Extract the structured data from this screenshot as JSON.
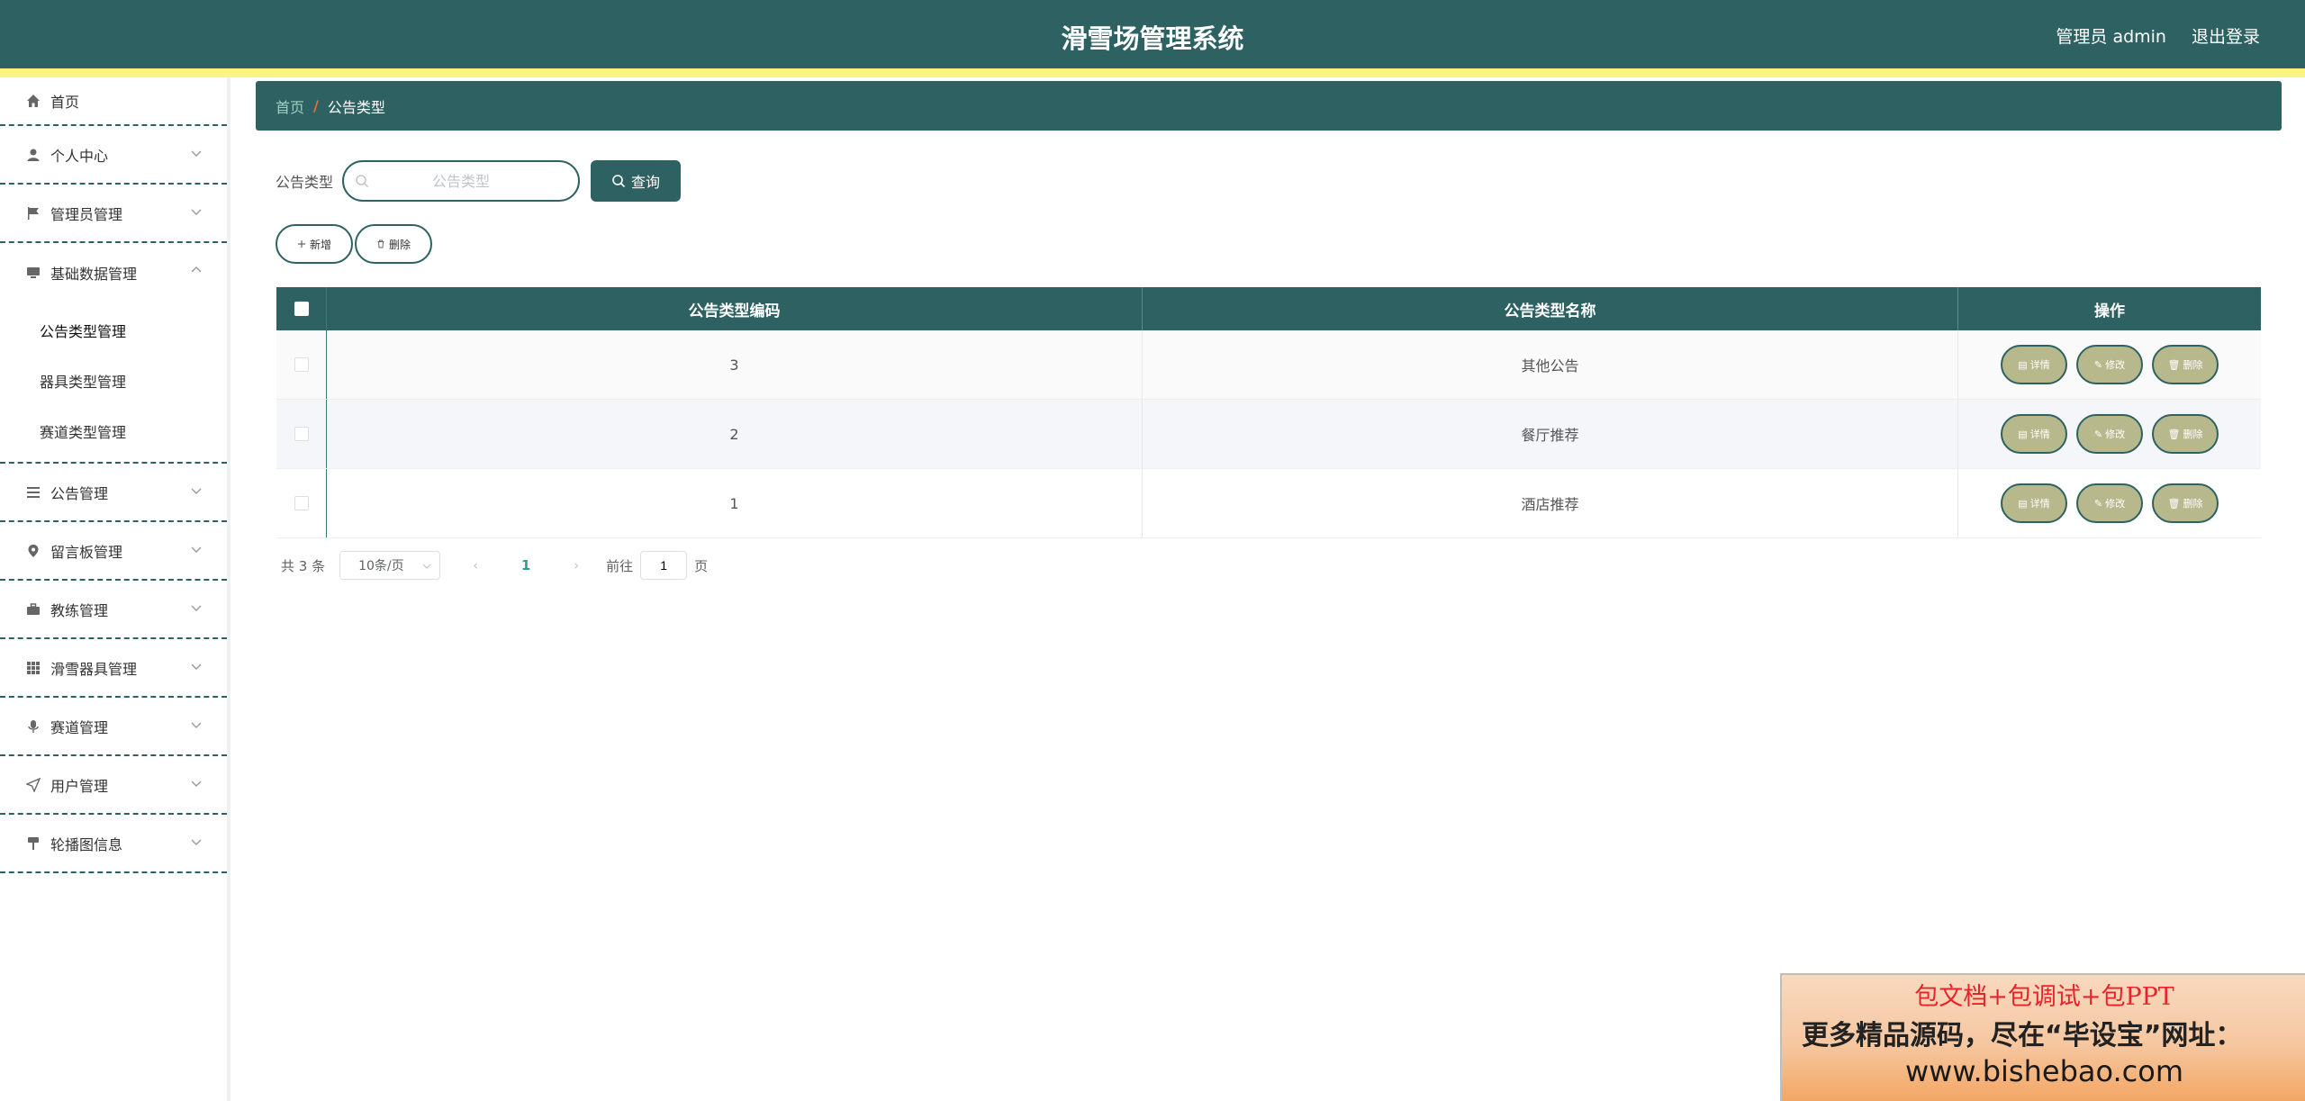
{
  "app": {
    "title": "滑雪场管理系统"
  },
  "header": {
    "user_label": "管理员 admin",
    "logout": "退出登录"
  },
  "sidebar": {
    "items": [
      {
        "label": "首页",
        "icon": "home-icon"
      },
      {
        "label": "个人中心",
        "icon": "user-icon"
      },
      {
        "label": "管理员管理",
        "icon": "flag-icon"
      },
      {
        "label": "基础数据管理",
        "icon": "monitor-icon",
        "expanded": true,
        "children": [
          {
            "label": "公告类型管理",
            "active": true
          },
          {
            "label": "器具类型管理"
          },
          {
            "label": "赛道类型管理"
          }
        ]
      },
      {
        "label": "公告管理",
        "icon": "menu-icon"
      },
      {
        "label": "留言板管理",
        "icon": "pin-icon"
      },
      {
        "label": "教练管理",
        "icon": "briefcase-icon"
      },
      {
        "label": "滑雪器具管理",
        "icon": "grid-icon"
      },
      {
        "label": "赛道管理",
        "icon": "microphone-icon"
      },
      {
        "label": "用户管理",
        "icon": "send-icon"
      },
      {
        "label": "轮播图信息",
        "icon": "paint-icon"
      }
    ]
  },
  "breadcrumb": {
    "home": "首页",
    "separator": "/",
    "current": "公告类型"
  },
  "search": {
    "label": "公告类型",
    "placeholder": "公告类型",
    "button": "查询"
  },
  "actions": {
    "add": "新增",
    "delete": "删除"
  },
  "table": {
    "columns": [
      "公告类型编码",
      "公告类型名称",
      "操作"
    ],
    "rows": [
      {
        "code": "3",
        "name": "其他公告"
      },
      {
        "code": "2",
        "name": "餐厅推荐"
      },
      {
        "code": "1",
        "name": "酒店推荐"
      }
    ],
    "row_actions": {
      "detail": "详情",
      "edit": "修改",
      "delete": "删除"
    }
  },
  "pagination": {
    "total": "共 3 条",
    "page_size": "10条/页",
    "current_page": "1",
    "goto_label": "前往",
    "goto_value": "1",
    "goto_suffix": "页"
  },
  "ad": {
    "line1": "包文档+包调试+包PPT",
    "line2": "更多精品源码，尽在“毕设宝”网址：",
    "line3": "www.bishebao.com"
  },
  "colors": {
    "primary": "#2e6262",
    "stripe": "#f9f57d",
    "op_button": "#b8b88d"
  }
}
